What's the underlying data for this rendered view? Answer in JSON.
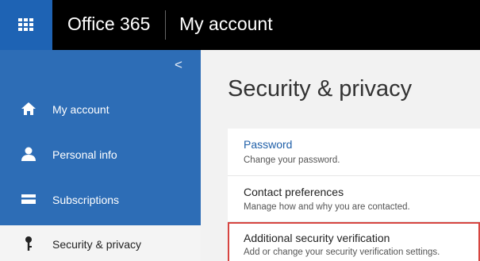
{
  "topbar": {
    "app_name": "Office 365",
    "page_name": "My account"
  },
  "sidebar": {
    "items": [
      {
        "label": "My account",
        "icon": "home-icon"
      },
      {
        "label": "Personal info",
        "icon": "person-icon"
      },
      {
        "label": "Subscriptions",
        "icon": "card-icon"
      },
      {
        "label": "Security & privacy",
        "icon": "key-icon",
        "active": true
      }
    ]
  },
  "main": {
    "title": "Security & privacy",
    "settings": [
      {
        "title": "Password",
        "description": "Change your password."
      },
      {
        "title": "Contact preferences",
        "description": "Manage how and why you are contacted."
      },
      {
        "title": "Additional security verification",
        "description": "Add or change your security verification settings."
      }
    ]
  },
  "colors": {
    "brand_blue": "#1e63b4",
    "sidebar_blue": "#2d6db6",
    "link_blue": "#1f5fa8",
    "highlight_red": "#d64541"
  }
}
